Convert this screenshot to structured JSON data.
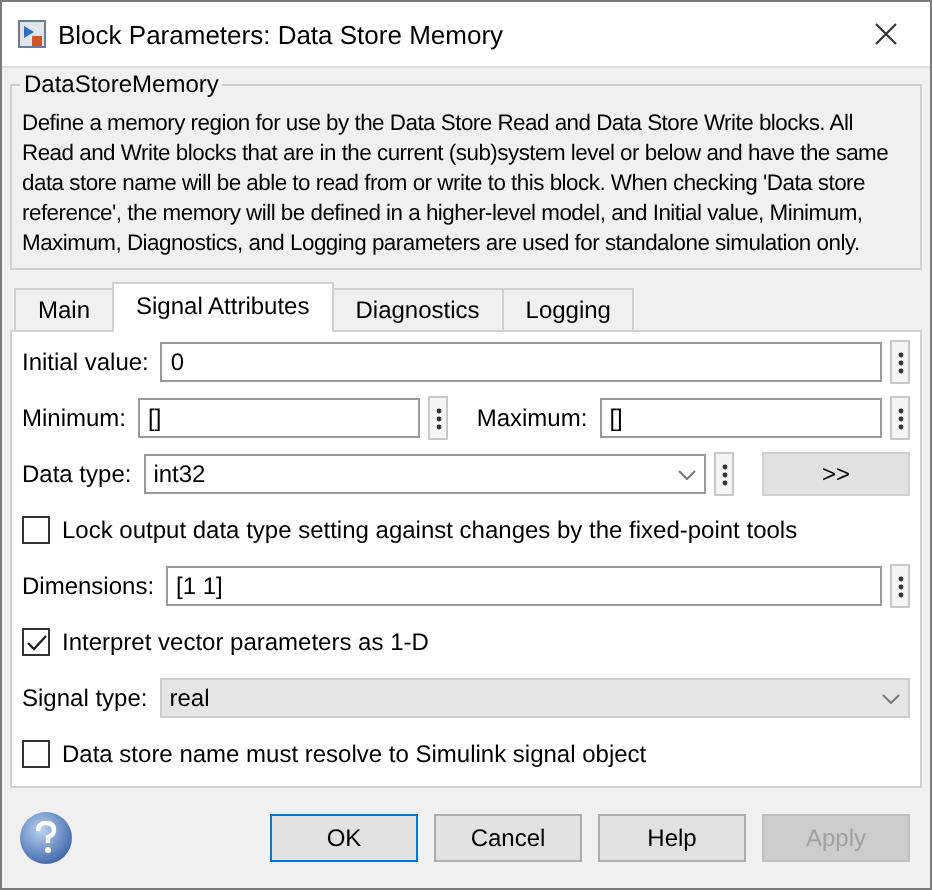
{
  "window": {
    "title": "Block Parameters: Data Store Memory"
  },
  "block": {
    "name": "DataStoreMemory",
    "description": "Define a memory region for use by the Data Store Read and Data Store Write blocks. All Read and Write blocks that are in the current (sub)system level or below and have the same data store name will be able to read from or write to this block. When checking 'Data store reference', the memory will be defined in a higher-level model, and Initial value, Minimum, Maximum, Diagnostics, and Logging parameters are used for standalone simulation only."
  },
  "tabs": [
    {
      "label": "Main",
      "selected": false
    },
    {
      "label": "Signal Attributes",
      "selected": true
    },
    {
      "label": "Diagnostics",
      "selected": false
    },
    {
      "label": "Logging",
      "selected": false
    }
  ],
  "params": [
    {
      "kind": "field",
      "label": "Initial value:",
      "value": "0"
    },
    {
      "kind": "pair",
      "fields": [
        {
          "label": "Minimum:",
          "value": "[]"
        },
        {
          "label": "Maximum:",
          "value": "[]"
        }
      ]
    },
    {
      "kind": "datatype",
      "label": "Data type:",
      "value": "int32",
      "button": ">>"
    },
    {
      "kind": "checkbox",
      "label": "Lock output data type setting against changes by the fixed-point tools",
      "checked": false
    },
    {
      "kind": "field",
      "label": "Dimensions:",
      "value": "[1 1]"
    },
    {
      "kind": "checkbox",
      "label": "Interpret vector parameters as 1-D",
      "checked": true
    },
    {
      "kind": "select",
      "label": "Signal type:",
      "value": "real"
    },
    {
      "kind": "checkbox",
      "label": "Data store name must resolve to Simulink signal object",
      "checked": false
    }
  ],
  "buttons": [
    {
      "label": "OK",
      "disabled": false,
      "default": true
    },
    {
      "label": "Cancel",
      "disabled": false,
      "default": false
    },
    {
      "label": "Help",
      "disabled": false,
      "default": false
    },
    {
      "label": "Apply",
      "disabled": true,
      "default": false
    }
  ]
}
